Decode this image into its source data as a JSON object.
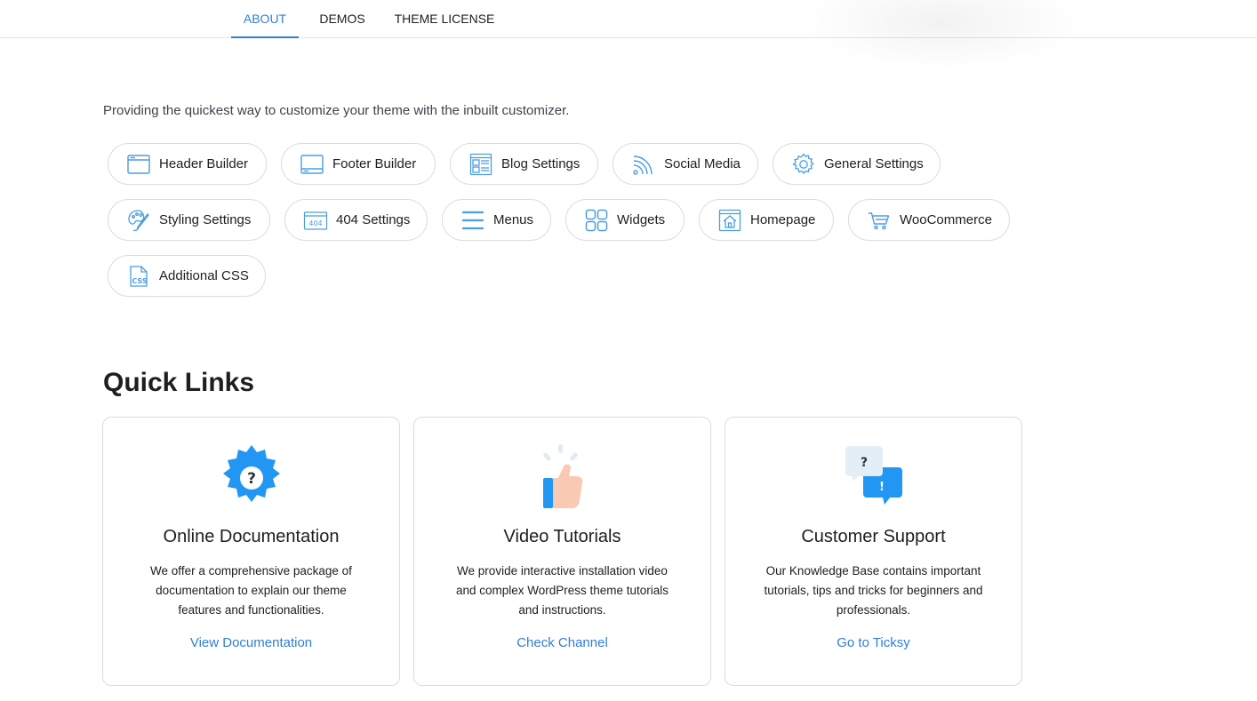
{
  "tabs": [
    {
      "label": "ABOUT",
      "active": true
    },
    {
      "label": "DEMOS",
      "active": false
    },
    {
      "label": "THEME LICENSE",
      "active": false
    }
  ],
  "intro": "Providing the quickest way to customize your theme with the inbuilt customizer.",
  "customizer_items": [
    {
      "label": "Header Builder",
      "icon": "header-builder-icon"
    },
    {
      "label": "Footer Builder",
      "icon": "footer-builder-icon"
    },
    {
      "label": "Blog Settings",
      "icon": "blog-settings-icon"
    },
    {
      "label": "Social Media",
      "icon": "rss-icon"
    },
    {
      "label": "General Settings",
      "icon": "gear-icon"
    },
    {
      "label": "Styling Settings",
      "icon": "palette-icon"
    },
    {
      "label": "404 Settings",
      "icon": "page-404-icon"
    },
    {
      "label": "Menus",
      "icon": "hamburger-menu-icon"
    },
    {
      "label": "Widgets",
      "icon": "widgets-grid-icon"
    },
    {
      "label": "Homepage",
      "icon": "homepage-icon"
    },
    {
      "label": "WooCommerce",
      "icon": "cart-icon"
    },
    {
      "label": "Additional CSS",
      "icon": "css-file-icon"
    }
  ],
  "quick_links": {
    "title": "Quick Links",
    "cards": [
      {
        "title": "Online Documentation",
        "description": "We offer a comprehensive package of documentation to explain our theme features and functionalities.",
        "link": "View Documentation",
        "icon": "gear-question-icon"
      },
      {
        "title": "Video Tutorials",
        "description": "We provide interactive installation video and complex WordPress theme tutorials and instructions.",
        "link": "Check Channel",
        "icon": "thumbs-up-icon"
      },
      {
        "title": "Customer Support",
        "description": "Our Knowledge Base contains important tutorials, tips and tricks for beginners and professionals.",
        "link": "Go to Ticksy",
        "icon": "chat-bubbles-icon"
      }
    ]
  },
  "colors": {
    "accent": "#2f7fd6",
    "icon_blue": "#4a9de0",
    "card_blue": "#2196f3"
  }
}
